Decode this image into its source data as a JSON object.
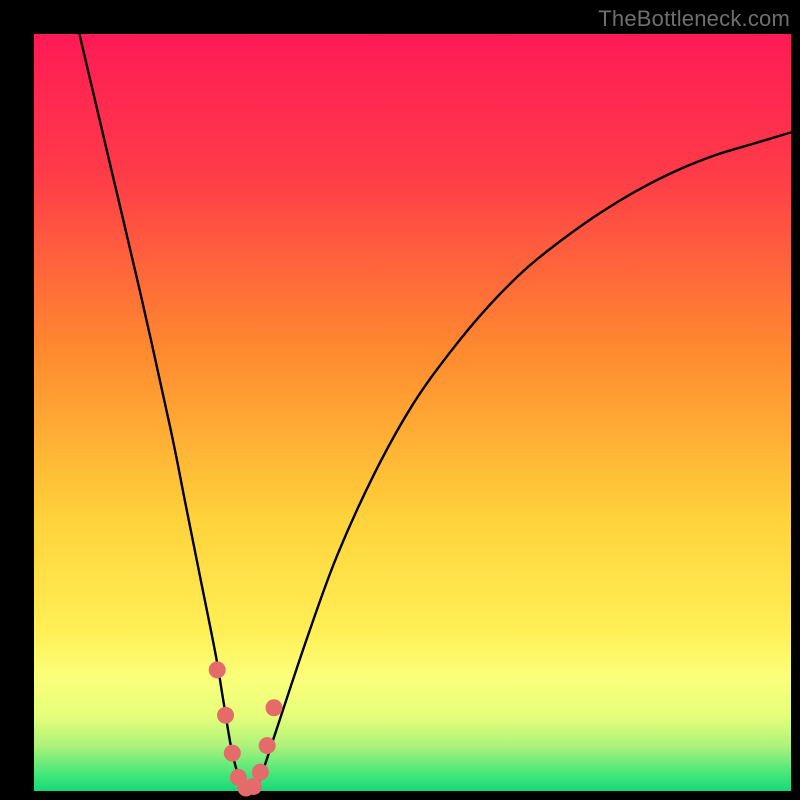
{
  "watermark": {
    "text": "TheBottleneck.com"
  },
  "colors": {
    "frame": "#000000",
    "gradient_stops": [
      {
        "pct": 0,
        "color": "#ff1a55"
      },
      {
        "pct": 18,
        "color": "#ff3a49"
      },
      {
        "pct": 42,
        "color": "#ff8a2f"
      },
      {
        "pct": 64,
        "color": "#ffd23a"
      },
      {
        "pct": 79,
        "color": "#fff056"
      },
      {
        "pct": 85,
        "color": "#fbff7a"
      },
      {
        "pct": 90,
        "color": "#e6ff7a"
      },
      {
        "pct": 94,
        "color": "#aef27a"
      },
      {
        "pct": 98,
        "color": "#3ee67a"
      },
      {
        "pct": 100,
        "color": "#14d97a"
      }
    ],
    "curve": "#000000",
    "marker_fill": "#e56b6b",
    "marker_stroke": "#c64e4e"
  },
  "chart_data": {
    "type": "line",
    "title": "",
    "xlabel": "",
    "ylabel": "",
    "xlim": [
      0,
      100
    ],
    "ylim": [
      0,
      100
    ],
    "series": [
      {
        "name": "bottleneck-curve",
        "x": [
          6,
          10,
          14,
          18,
          20,
          22,
          24,
          25,
          26,
          27,
          28,
          29,
          30,
          32,
          36,
          40,
          45,
          50,
          55,
          60,
          65,
          70,
          75,
          80,
          85,
          90,
          95,
          100
        ],
        "y": [
          100,
          83,
          66,
          48,
          38,
          28,
          18,
          12,
          6,
          2,
          0,
          0,
          2,
          8,
          20,
          31,
          42,
          51,
          58,
          64,
          69,
          73,
          76.5,
          79.5,
          82,
          84,
          85.5,
          87
        ]
      }
    ],
    "markers": {
      "name": "highlight-points",
      "x": [
        24.2,
        25.3,
        26.2,
        27.0,
        28.0,
        29.0,
        29.9,
        30.8,
        31.7
      ],
      "y": [
        16.0,
        10.0,
        5.0,
        1.8,
        0.4,
        0.6,
        2.5,
        6.0,
        11.0
      ]
    }
  }
}
